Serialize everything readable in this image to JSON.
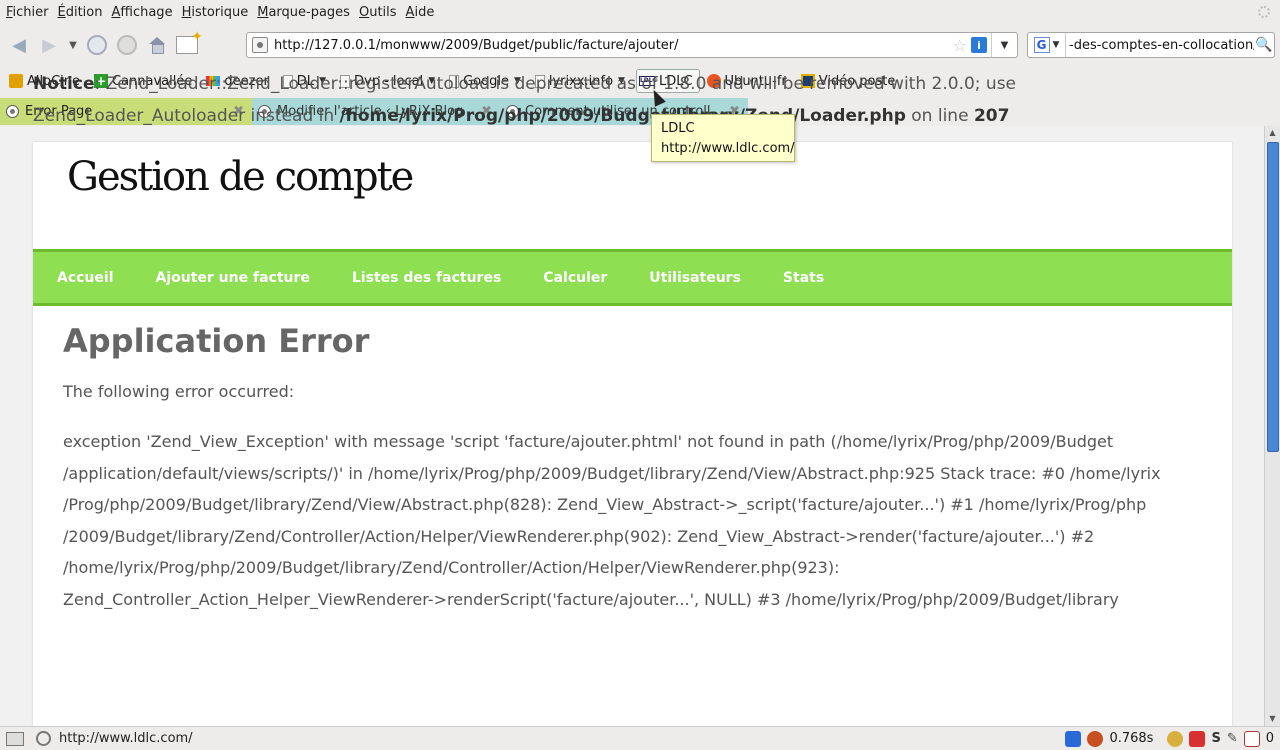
{
  "menu": {
    "items": [
      {
        "acc": "F",
        "rest": "ichier"
      },
      {
        "acc": "É",
        "rest": "dition"
      },
      {
        "acc": "A",
        "rest": "ffichage"
      },
      {
        "acc": "H",
        "rest": "istorique"
      },
      {
        "acc": "M",
        "rest": "arque-pages"
      },
      {
        "acc": "O",
        "rest": "utils"
      },
      {
        "acc": "A",
        "rest": "ide"
      }
    ]
  },
  "navbar": {
    "url": "http://127.0.0.1/monwww/2009/Budget/public/facture/ajouter/",
    "search_engine_letter": "G",
    "search_text": "-des-comptes-en-collocation/"
  },
  "bookmarks": [
    {
      "label": "AlloCine",
      "icon": "allocine-icon"
    },
    {
      "label": "Cannavallée",
      "icon": "plus-icon"
    },
    {
      "label": "deezer",
      "icon": "deezer-icon"
    },
    {
      "label": "DL",
      "icon": "folder-icon",
      "menu": true
    },
    {
      "label": "Dvp - local",
      "icon": "folder-icon",
      "menu": true
    },
    {
      "label": "Google",
      "icon": "folder-icon",
      "menu": true
    },
    {
      "label": "lyrixx.info",
      "icon": "folder-icon",
      "menu": true
    },
    {
      "label": "LDLC",
      "icon": "ldlc-icon",
      "ldlc_icon_text": "LDLC"
    },
    {
      "label": "Ubuntu-fr",
      "icon": "ubuntu-icon"
    },
    {
      "label": "Vidéo poste",
      "icon": "video-icon"
    }
  ],
  "tabs": [
    {
      "label": "Error Page",
      "active": true
    },
    {
      "label": "Modifier l'article ‹ LyRiX Blog ...",
      "active": false
    },
    {
      "label": "Comment utiliser un controll...",
      "active": false
    }
  ],
  "tooltip": {
    "title": "LDLC",
    "url": "http://www.ldlc.com/"
  },
  "page": {
    "notice_label": "Notice",
    "notice_text": ": Zend_Loader::Zend_Loader::registerAutoload is deprecated as of 1.8.0 and will be removed with 2.0.0; use Zend_Loader_Autoloader instead in",
    "notice_file": "/home/lyrix/Prog/php/2009/Budget/library/Zend/Loader.php",
    "notice_online": "on line",
    "notice_line": "207",
    "site_title": "Gestion de compte",
    "nav": [
      "Accueil",
      "Ajouter une facture",
      "Listes des factures",
      "Calculer",
      "Utilisateurs",
      "Stats"
    ],
    "error_heading": "Application Error",
    "error_intro": "The following error occurred:",
    "error_trace": "exception 'Zend_View_Exception' with message 'script 'facture/ajouter.phtml' not found in path (/home/lyrix/Prog/php/2009/Budget /application/default/views/scripts/)' in /home/lyrix/Prog/php/2009/Budget/library/Zend/View/Abstract.php:925 Stack trace: #0 /home/lyrix /Prog/php/2009/Budget/library/Zend/View/Abstract.php(828): Zend_View_Abstract->_script('facture/ajouter...') #1 /home/lyrix/Prog/php /2009/Budget/library/Zend/Controller/Action/Helper/ViewRenderer.php(902): Zend_View_Abstract->render('facture/ajouter...') #2 /home/lyrix/Prog/php/2009/Budget/library/Zend/Controller/Action/Helper/ViewRenderer.php(923): Zend_Controller_Action_Helper_ViewRenderer->renderScript('facture/ajouter...', NULL) #3 /home/lyrix/Prog/php/2009/Budget/library"
  },
  "status": {
    "text": "http://www.ldlc.com/",
    "timing": "0.768s",
    "count": "0"
  },
  "colors": {
    "nav_green": "#8ee052",
    "active_tab": "#c8dd78",
    "inactive_tab": "#a8d8d8",
    "tooltip_bg": "#ffffcc"
  }
}
